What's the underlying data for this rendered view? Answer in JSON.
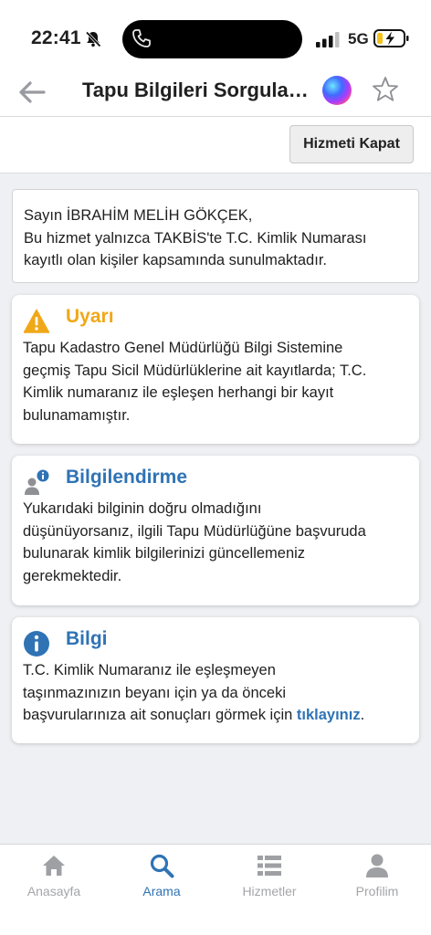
{
  "status_bar": {
    "time": "22:41",
    "network": "5G",
    "icons": [
      "bell-slash-icon",
      "phone-icon",
      "signal-icon",
      "battery-charging-icon"
    ]
  },
  "nav": {
    "title": "Tapu Bilgileri Sorgula…",
    "icons": [
      "back-arrow-icon",
      "siri-icon",
      "star-icon"
    ]
  },
  "actions": {
    "close_service_label": "Hizmeti Kapat"
  },
  "greeting": {
    "line1": "Sayın İBRAHİM MELİH GÖKÇEK,",
    "line2": "Bu hizmet yalnızca TAKBİS'te T.C. Kimlik Numarası",
    "line3": "kayıtlı olan kişiler kapsamında sunulmaktadır."
  },
  "warning": {
    "title": "Uyarı",
    "icon": "warning-triangle-icon",
    "color": "#f0a818",
    "lines": [
      "Tapu Kadastro Genel Müdürlüğü Bilgi Sistemine",
      "geçmiş Tapu Sicil Müdürlüklerine ait kayıtlarda; T.C.",
      "Kimlik numaranız ile eşleşen herhangi bir kayıt",
      "bulunamamıştır."
    ]
  },
  "notice": {
    "title": "Bilgilendirme",
    "icon": "user-info-icon",
    "color": "#2f73b5",
    "lines": [
      "Yukarıdaki bilginin doğru olmadığını",
      "düşünüyorsanız, ilgili Tapu Müdürlüğüne başvuruda",
      "bulunarak kimlik bilgilerinizi güncellemeniz",
      "gerekmektedir."
    ]
  },
  "info": {
    "title": "Bilgi",
    "icon": "info-circle-icon",
    "lines": [
      "T.C. Kimlik Numaranız ile eşleşmeyen",
      "taşınmazınızın beyanı için ya da önceki",
      "başvurularınıza ait sonuçları görmek için "
    ],
    "link_label": "tıklayınız",
    "tail": "."
  },
  "tabs": [
    {
      "label": "Anasayfa",
      "icon": "home-icon",
      "active": false
    },
    {
      "label": "Arama",
      "icon": "search-icon",
      "active": true
    },
    {
      "label": "Hizmetler",
      "icon": "list-icon",
      "active": false
    },
    {
      "label": "Profilim",
      "icon": "user-icon",
      "active": false
    }
  ]
}
